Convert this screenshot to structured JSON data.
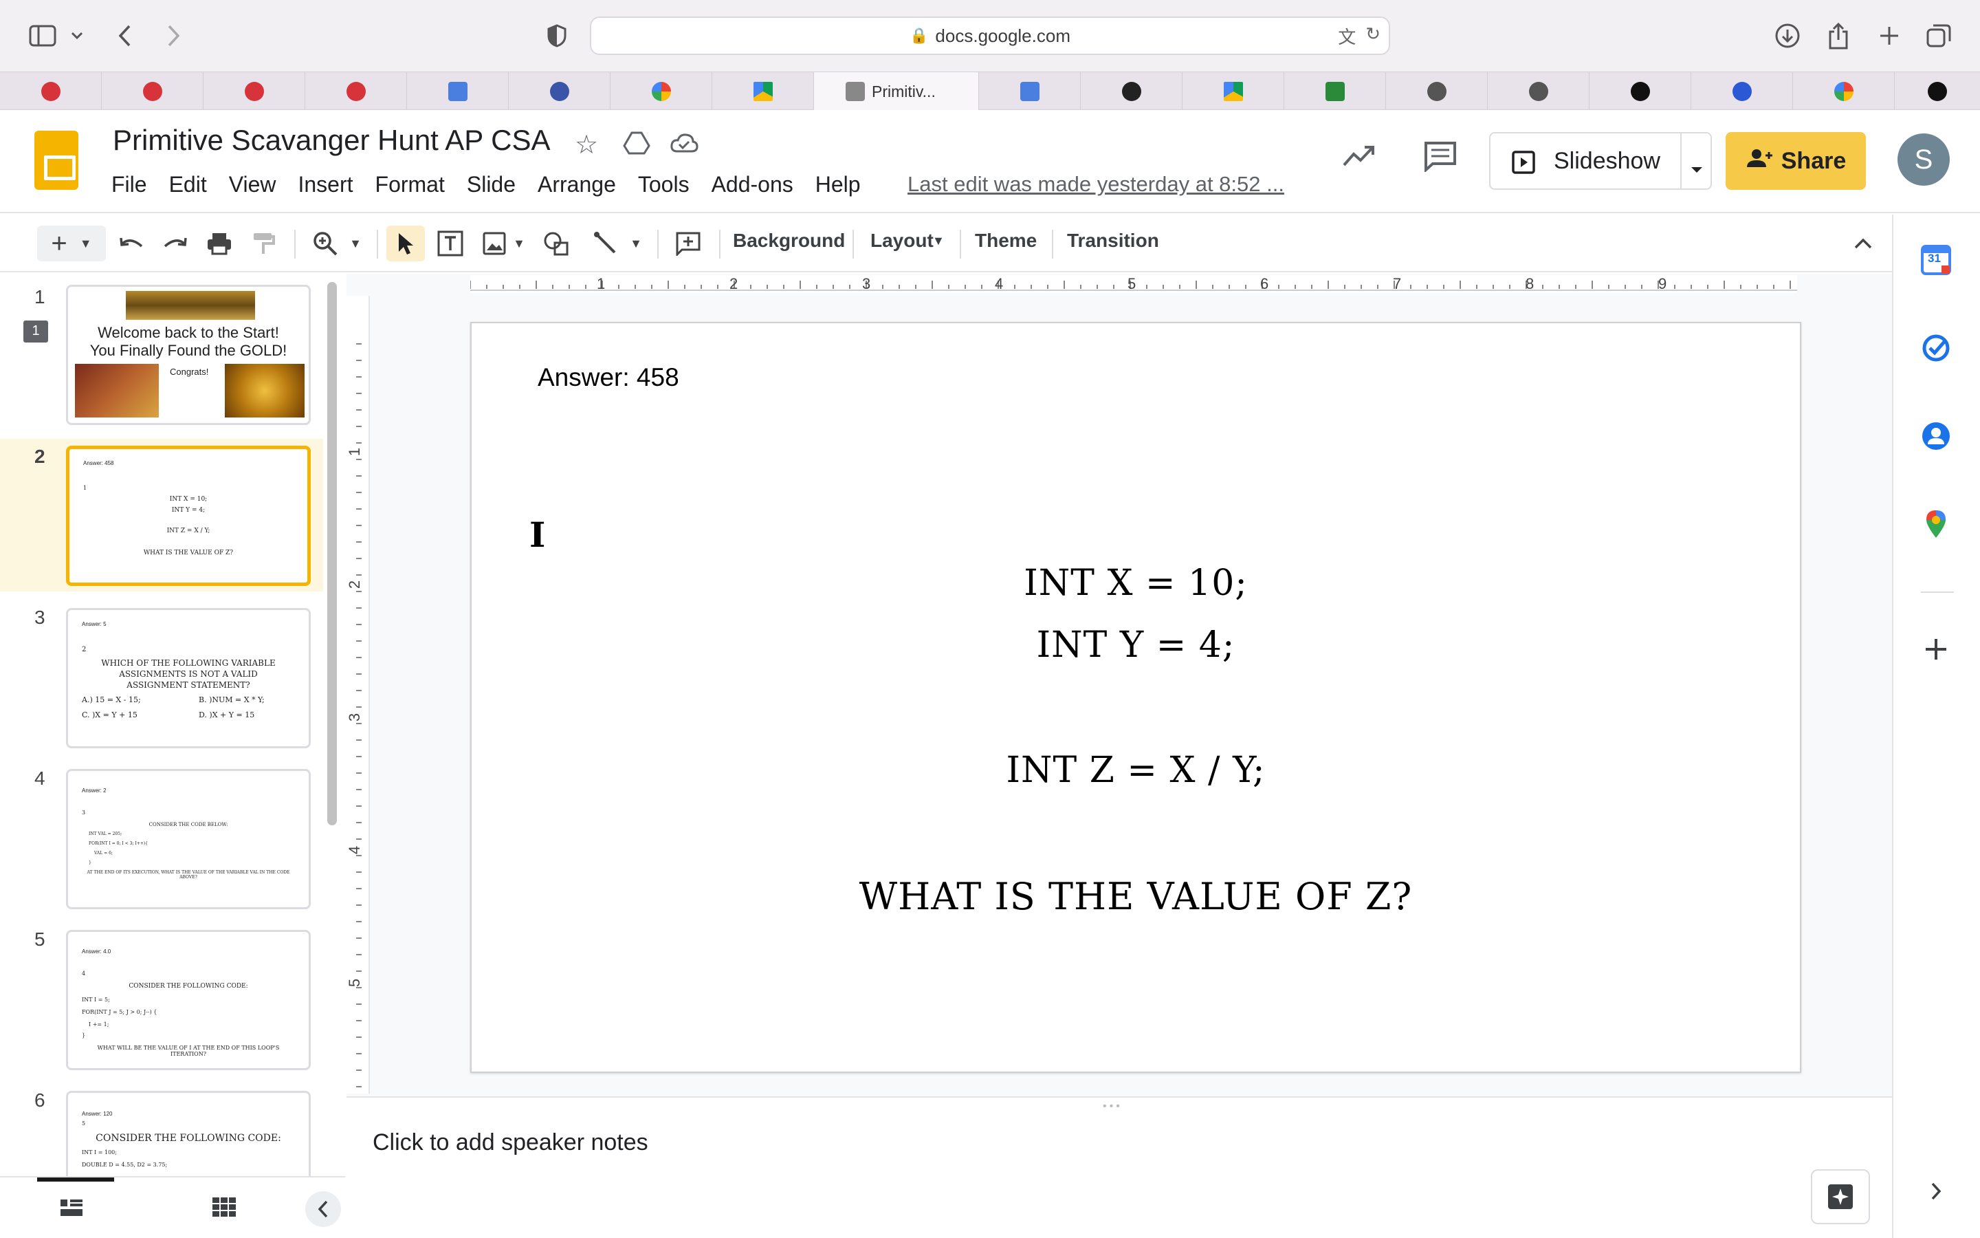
{
  "browser": {
    "address": "docs.google.com",
    "active_tab_label": "Primitiv..."
  },
  "app": {
    "doc_title": "Primitive Scavanger Hunt AP CSA",
    "menu": [
      "File",
      "Edit",
      "View",
      "Insert",
      "Format",
      "Slide",
      "Arrange",
      "Tools",
      "Add-ons",
      "Help"
    ],
    "last_edit": "Last edit was made yesterday at 8:52 ...",
    "slideshow_label": "Slideshow",
    "share_label": "Share",
    "avatar_initial": "S"
  },
  "toolbar": {
    "background": "Background",
    "layout": "Layout",
    "theme": "Theme",
    "transition": "Transition"
  },
  "filmstrip": {
    "comment_count": "1",
    "slides": [
      {
        "num": "1",
        "line1": "Welcome back to the Start!",
        "line2": "You Finally Found the GOLD!",
        "line3": "Congrats!"
      },
      {
        "num": "2",
        "answer": "Answer: 458",
        "n": "1",
        "l1": "INT X = 10;",
        "l2": "INT Y = 4;",
        "l3": "INT Z = X / Y;",
        "l4": "WHAT IS THE  VALUE OF Z?"
      },
      {
        "num": "3",
        "answer": "Answer: 5",
        "n": "2",
        "l1": "WHICH OF THE  FOLLOWING VARIABLE",
        "l2": "ASSIGNMENTS IS NOT A VALID",
        "l3": "ASSIGNMENT STATEMENT?",
        "a": "A.) 15 = X - 15;",
        "b": "B. )NUM = X * Y;",
        "c": "C. )X = Y + 15",
        "d": "D. )X + Y = 15"
      },
      {
        "num": "4",
        "answer": "Answer: 2",
        "n": "3",
        "l1": "CONSIDER THE  CODE BELOW:",
        "l2": "INT VAL = 205;",
        "l3": "FOR(INT I = 0; I < 3; I++){",
        "l4": "VAL = 6;",
        "l5": "}",
        "l6": "AT THE  END OF ITS EXECUTION, WHAT IS THE  VALUE OF THE VARIABLE VAL IN THE  CODE ABOVE?"
      },
      {
        "num": "5",
        "answer": "Answer: 4.0",
        "n": "4",
        "l1": "CONSIDER THE  FOLLOWING CODE:",
        "l2": "INT I = 5;",
        "l3": "FOR(INT J = 5; J > 0; J--) {",
        "l4": "I += 1;",
        "l5": "}",
        "l6": "WHAT WILL BE THE  VALUE OF I AT THE  END OF THIS LOOP'S ITERATION?"
      },
      {
        "num": "6",
        "answer": "Answer: 120",
        "n": "5",
        "l1": "CONSIDER THE  FOLLOWING CODE:",
        "l2": "INT I = 100;",
        "l3": "DOUBLE D = 4.55, D2 = 3.75;"
      }
    ]
  },
  "ruler": {
    "h": [
      "1",
      "2",
      "3",
      "4",
      "5",
      "6",
      "7",
      "8",
      "9"
    ],
    "v": [
      "1",
      "2",
      "3",
      "4",
      "5"
    ]
  },
  "slide": {
    "answer": "Answer: 458",
    "cursor": "I",
    "line1": "INT X = 10;",
    "line2": "INT Y = 4;",
    "line3": "INT Z = X / Y;",
    "question": "WHAT IS THE  VALUE OF Z?"
  },
  "notes": {
    "placeholder": "Click to add speaker notes"
  },
  "side_panel": {
    "calendar_day": "31"
  }
}
